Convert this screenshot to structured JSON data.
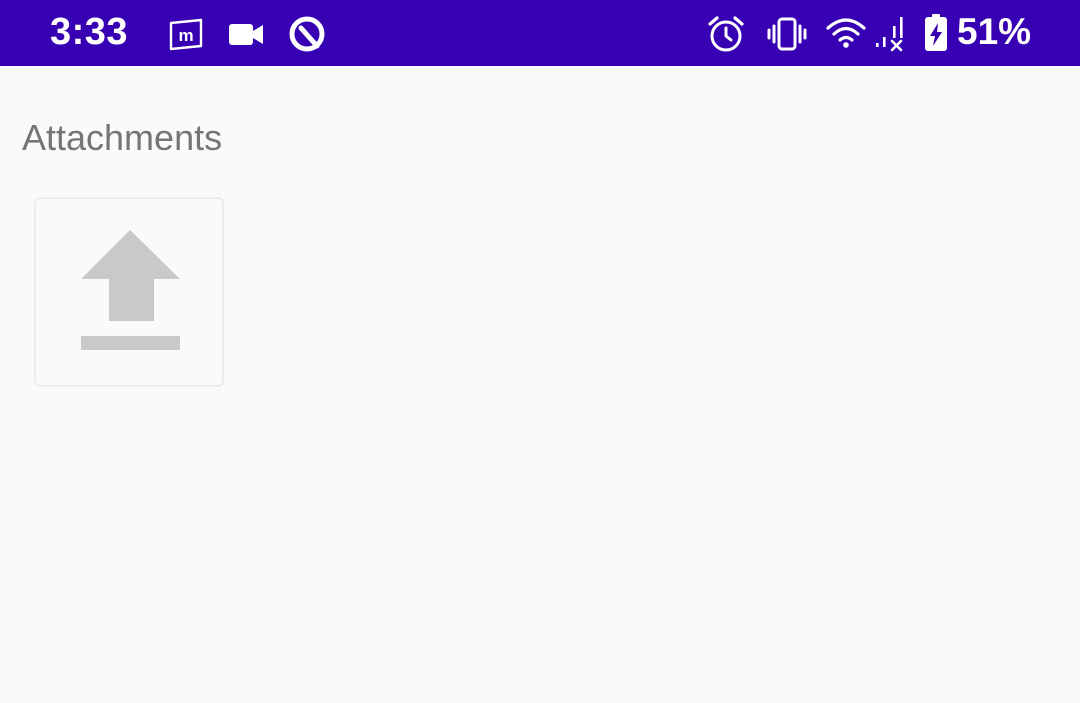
{
  "status_bar": {
    "time": "3:33",
    "battery_percent": "51%",
    "background_color": "#3700b3",
    "left_icons": [
      "moneycontrol-app-icon",
      "video-camera-icon",
      "app-notification-icon"
    ],
    "right_icons": [
      "alarm-clock-icon",
      "vibrate-icon",
      "wifi-icon",
      "mobile-signal-no-service-icon",
      "battery-charging-icon"
    ]
  },
  "attachments": {
    "title": "Attachments",
    "upload_icon": "upload-icon",
    "upload_icon_color": "#c9c9c9"
  }
}
